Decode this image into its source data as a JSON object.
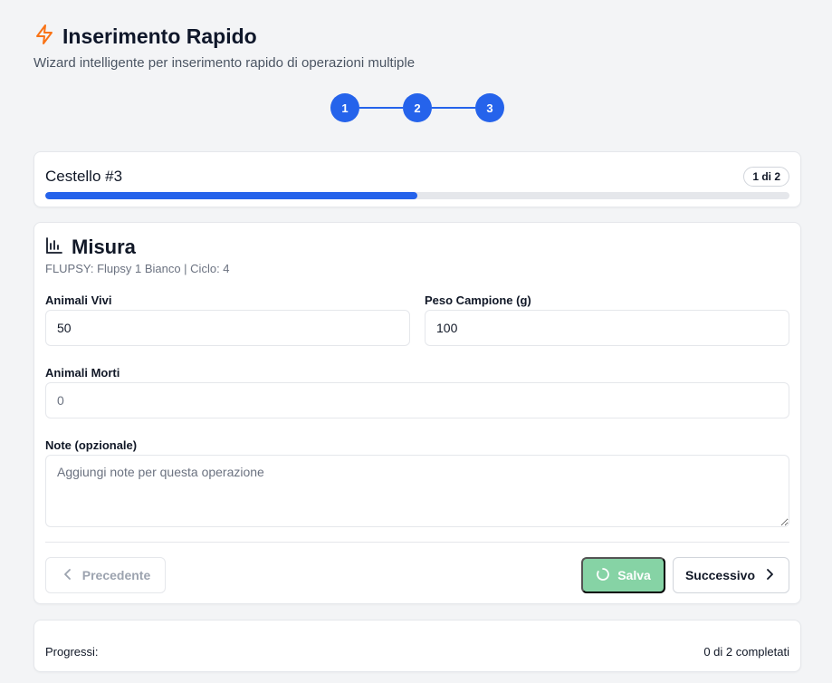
{
  "header": {
    "title": "Inserimento Rapido",
    "subtitle": "Wizard intelligente per inserimento rapido di operazioni multiple",
    "icon": "lightning-icon",
    "icon_color": "#f97316"
  },
  "stepper": {
    "steps": [
      "1",
      "2",
      "3"
    ],
    "active_color": "#2563eb"
  },
  "basket": {
    "name": "Cestello #3",
    "badge": "1 di 2",
    "progress_fraction": 0.5
  },
  "form": {
    "icon": "bar-chart-icon",
    "title": "Misura",
    "meta": "FLUPSY: Flupsy 1 Bianco | Ciclo: 4",
    "fields": {
      "animali_vivi": {
        "label": "Animali Vivi",
        "value": "50",
        "placeholder": ""
      },
      "peso_campione": {
        "label": "Peso Campione (g)",
        "value": "100",
        "placeholder": ""
      },
      "animali_morti": {
        "label": "Animali Morti",
        "value": "",
        "placeholder": "0"
      },
      "note": {
        "label": "Note (opzionale)",
        "value": "",
        "placeholder": "Aggiungi note per questa operazione"
      }
    },
    "buttons": {
      "prev": "Precedente",
      "save": "Salva",
      "next": "Successivo"
    },
    "save_color": "#86d3a5"
  },
  "progress": {
    "label": "Progressi:",
    "value": "0 di 2 completati"
  }
}
